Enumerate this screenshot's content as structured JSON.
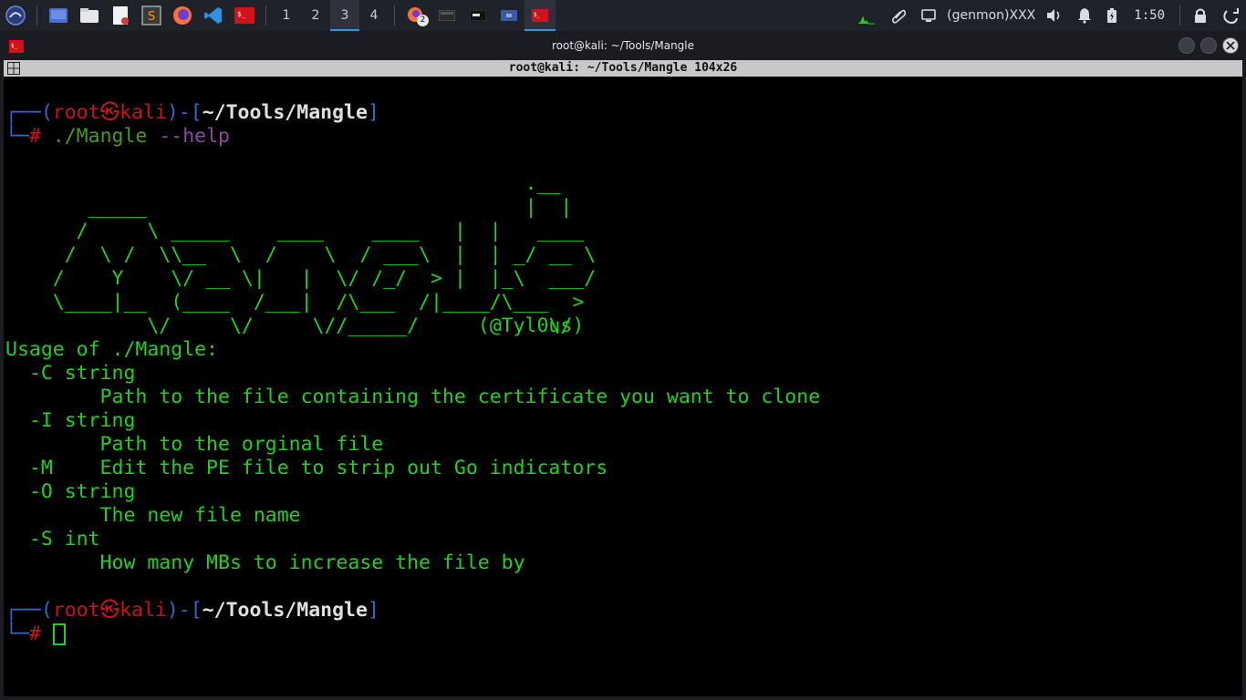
{
  "panel": {
    "workspaces": [
      "1",
      "2",
      "3",
      "4"
    ],
    "active_workspace": "3",
    "genmon": "(genmon)XXX",
    "clock": "1:50",
    "badge_count": "2",
    "apps": [
      "kali-menu-icon",
      "desktop-icon",
      "file-manager-icon",
      "text-editor-icon",
      "sublime-icon",
      "firefox-icon",
      "vscode-icon",
      "terminal-icon"
    ],
    "tray": [
      "cpu-graph-icon",
      "paperclip-icon",
      "monitor-icon",
      "volume-icon",
      "bell-icon",
      "battery-icon",
      "lock-icon",
      "power-icon"
    ]
  },
  "window": {
    "title": "root@kali: ~/Tools/Mangle",
    "terminal_header": "root@kali: ~/Tools/Mangle 104x26"
  },
  "terminal": {
    "prompt1": {
      "corner": "┌──(",
      "user": "root",
      "sym": "㉿",
      "host": "kali",
      "mid": ")-[",
      "path": "~/Tools/Mangle",
      "end": "]",
      "corner2": "└─",
      "hash": "#",
      "cmd": "./Mangle",
      "arg": "--help"
    },
    "ascii": [
      "                                            .__",
      "       _____                                |  |",
      "      /     \\ _____    ____    ____   |  |   ____",
      "     /  \\ /  \\\\__  \\  /    \\  / ___\\  |  | _/ __ \\",
      "    /    Y    \\/ __ \\|   |  \\/ /_/  > |  |_\\  ___/",
      "    \\____|__  (____  /___|  /\\___  /|____/\\___  >",
      "            \\/     \\/     \\//_____/           \\/",
      "                                        (@Tyl0us)"
    ],
    "output": [
      "Usage of ./Mangle:",
      "  -C string",
      "        Path to the file containing the certificate you want to clone",
      "  -I string",
      "        Path to the orginal file",
      "  -M    Edit the PE file to strip out Go indicators",
      "  -O string",
      "        The new file name",
      "  -S int",
      "        How many MBs to increase the file by"
    ],
    "prompt2": {
      "corner": "┌──(",
      "user": "root",
      "sym": "㉿",
      "host": "kali",
      "mid": ")-[",
      "path": "~/Tools/Mangle",
      "end": "]",
      "corner2": "└─",
      "hash": "#"
    }
  }
}
